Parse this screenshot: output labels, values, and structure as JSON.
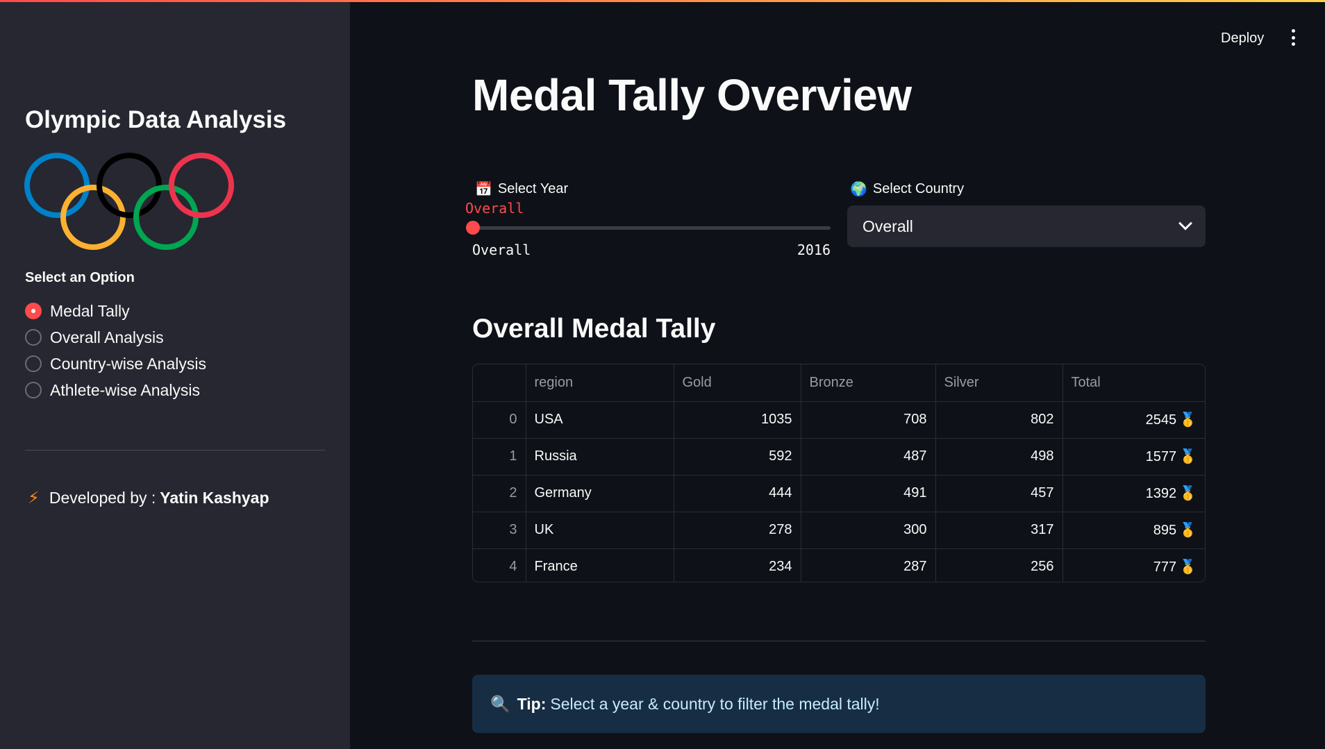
{
  "sidebar": {
    "title": "Olympic Data Analysis",
    "option_label": "Select an Option",
    "options": [
      {
        "label": "Medal Tally",
        "selected": true
      },
      {
        "label": "Overall Analysis",
        "selected": false
      },
      {
        "label": "Country-wise Analysis",
        "selected": false
      },
      {
        "label": "Athlete-wise Analysis",
        "selected": false
      }
    ],
    "dev_prefix": "Developed by :",
    "dev_name": "Yatin Kashyap",
    "ring_colors": [
      "#0081c8",
      "#000000",
      "#ee334e",
      "#fcb131",
      "#00a651"
    ]
  },
  "header": {
    "deploy_label": "Deploy"
  },
  "main": {
    "title": "Medal Tally Overview",
    "year_label": "Select Year",
    "year_value": "Overall",
    "year_min": "Overall",
    "year_max": "2016",
    "country_label": "Select Country",
    "country_value": "Overall",
    "section_title": "Overall Medal Tally",
    "table": {
      "columns": [
        "",
        "region",
        "Gold",
        "Bronze",
        "Silver",
        "Total"
      ],
      "rows": [
        {
          "idx": "0",
          "region": "USA",
          "gold": "1035",
          "bronze": "708",
          "silver": "802",
          "total": "2545"
        },
        {
          "idx": "1",
          "region": "Russia",
          "gold": "592",
          "bronze": "487",
          "silver": "498",
          "total": "1577"
        },
        {
          "idx": "2",
          "region": "Germany",
          "gold": "444",
          "bronze": "491",
          "silver": "457",
          "total": "1392"
        },
        {
          "idx": "3",
          "region": "UK",
          "gold": "278",
          "bronze": "300",
          "silver": "317",
          "total": "895"
        },
        {
          "idx": "4",
          "region": "France",
          "gold": "234",
          "bronze": "287",
          "silver": "256",
          "total": "777"
        }
      ]
    },
    "tip_bold": "Tip:",
    "tip_text": "Select a year & country to filter the medal tally!"
  },
  "colors": {
    "accent": "#ff4b4b",
    "background": "#0e1117",
    "sidebar": "#262730",
    "tip_bg": "#172d43"
  }
}
